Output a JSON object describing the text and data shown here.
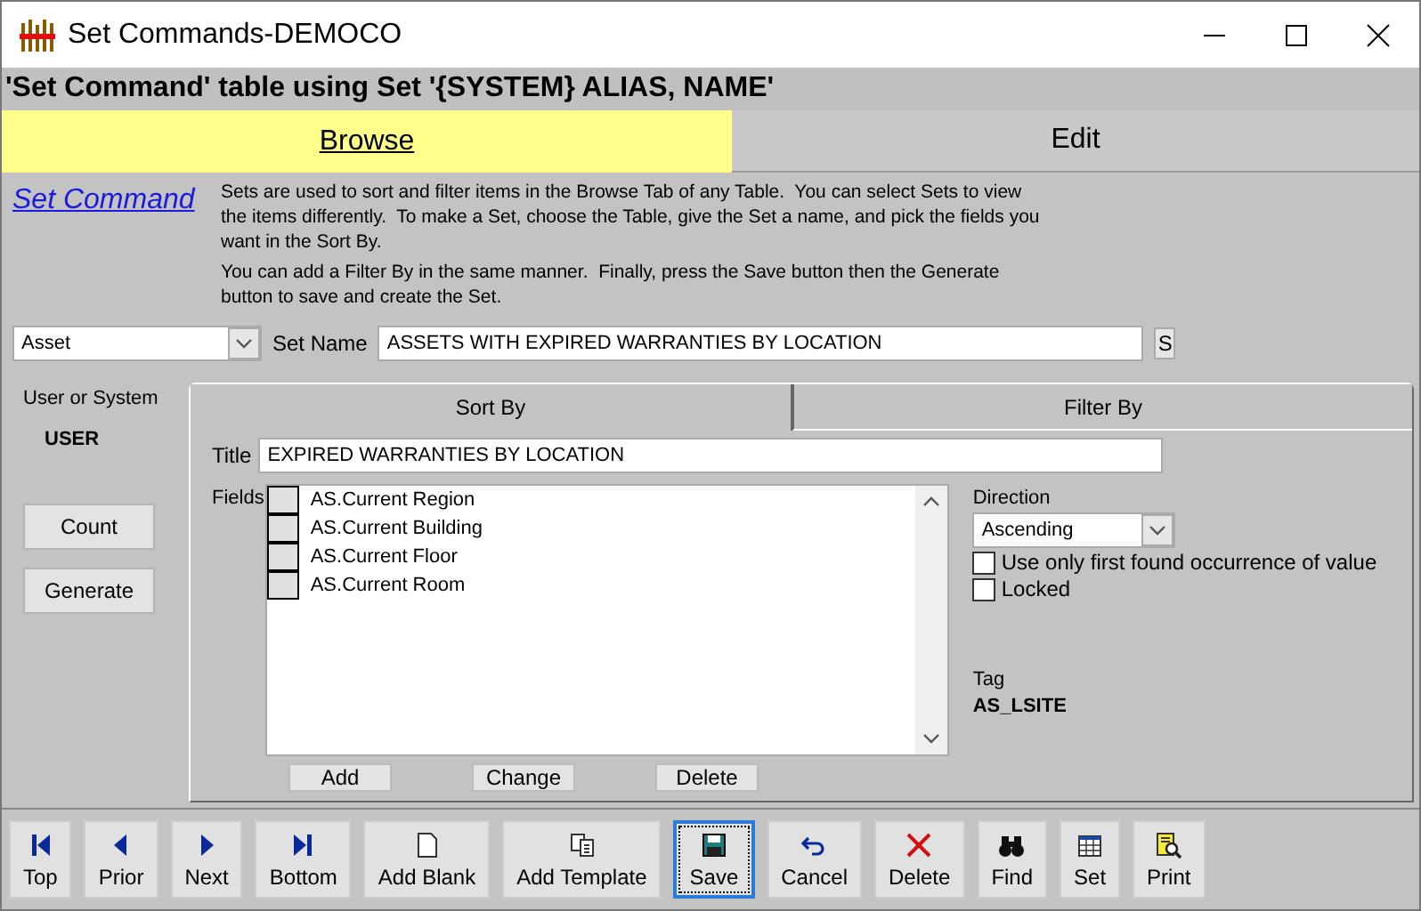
{
  "window": {
    "title": "Set Commands-DEMOCO"
  },
  "header": "'Set Command' table using Set '{SYSTEM} ALIAS, NAME'",
  "tabs": [
    {
      "label": "Browse",
      "selected": true
    },
    {
      "label": "Edit",
      "selected": false
    }
  ],
  "help": {
    "link": "Set Command",
    "paragraphs": [
      "Sets are used to sort and filter items in the Browse Tab of any Table.  You can select Sets to view the items differently.  To make a Set, choose the Table, give the Set a name, and pick the fields you want in the Sort By.",
      "You can add a Filter By in the same manner.  Finally, press the Save button then the Generate button to save and create the Set."
    ]
  },
  "table_select": {
    "value": "Asset"
  },
  "set_name": {
    "label": "Set Name",
    "value": "ASSETS WITH EXPIRED WARRANTIES BY LOCATION",
    "button": "S"
  },
  "user_or_system": {
    "label": "User or System",
    "value": "USER"
  },
  "side_buttons": [
    "Count",
    "Generate"
  ],
  "sub_tabs": [
    {
      "label": "Sort By",
      "selected": true
    },
    {
      "label": "Filter By",
      "selected": false
    }
  ],
  "title_field": {
    "label": "Title",
    "value": "EXPIRED WARRANTIES BY LOCATION"
  },
  "fields": {
    "label": "Fields",
    "items": [
      {
        "text": "AS.Current Region",
        "checked": false
      },
      {
        "text": "AS.Current Building",
        "checked": false
      },
      {
        "text": "AS.Current Floor",
        "checked": false
      },
      {
        "text": "AS.Current Room",
        "checked": false
      }
    ]
  },
  "direction": {
    "label": "Direction",
    "value": "Ascending"
  },
  "options": [
    {
      "label": "Use only first found occurrence of value",
      "checked": false
    },
    {
      "label": "Locked",
      "checked": false
    }
  ],
  "tag": {
    "label": "Tag",
    "value": "AS_LSITE"
  },
  "list_buttons": [
    "Add",
    "Change",
    "Delete"
  ],
  "toolbar": [
    {
      "label": "Top",
      "kind": "first",
      "focused": false
    },
    {
      "label": "Prior",
      "kind": "prior",
      "focused": false
    },
    {
      "label": "Next",
      "kind": "next",
      "focused": false
    },
    {
      "label": "Bottom",
      "kind": "last",
      "focused": false
    },
    {
      "label": "Add Blank",
      "kind": "blank",
      "focused": false
    },
    {
      "label": "Add Template",
      "kind": "template",
      "focused": false
    },
    {
      "label": "Save",
      "kind": "save",
      "focused": true
    },
    {
      "label": "Cancel",
      "kind": "cancel",
      "focused": false
    },
    {
      "label": "Delete",
      "kind": "delete",
      "focused": false
    },
    {
      "label": "Find",
      "kind": "find",
      "focused": false
    },
    {
      "label": "Set",
      "kind": "set",
      "focused": false
    },
    {
      "label": "Print",
      "kind": "print",
      "focused": false
    }
  ]
}
